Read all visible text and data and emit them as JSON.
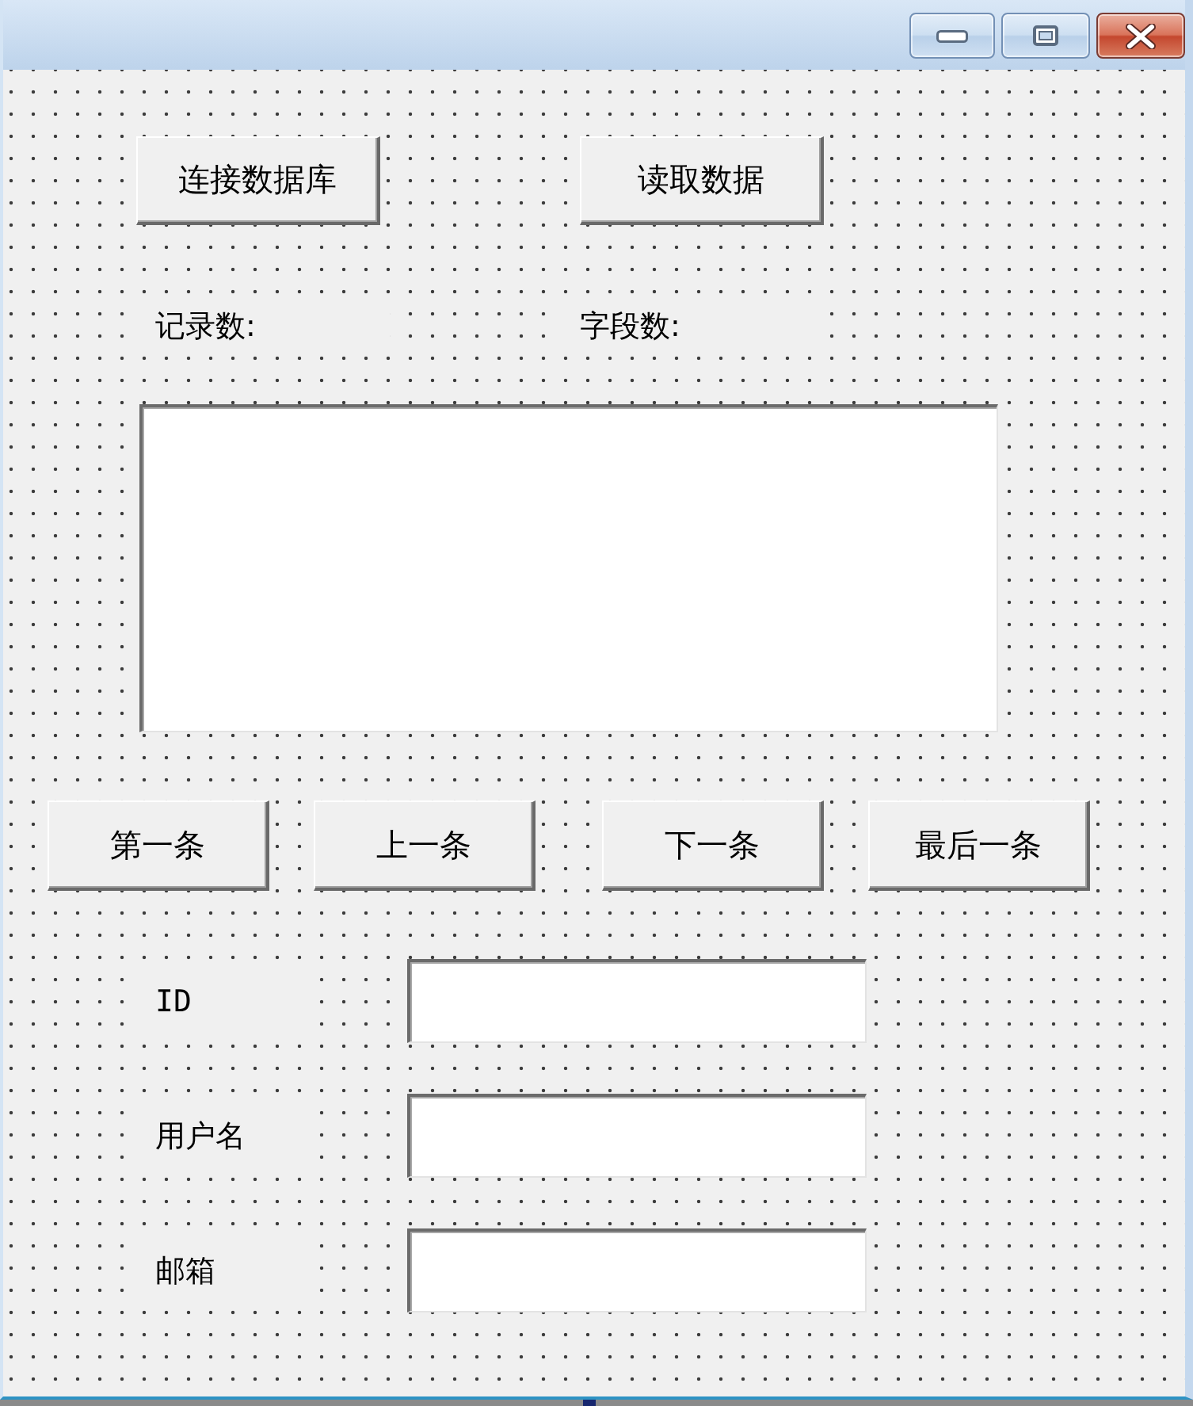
{
  "top_buttons": [
    {
      "label": "连接数据库"
    },
    {
      "label": "读取数据"
    }
  ],
  "count_labels": [
    {
      "label": "记录数:"
    },
    {
      "label": "字段数:"
    }
  ],
  "navigation_buttons": [
    {
      "label": "第一条"
    },
    {
      "label": "上一条"
    },
    {
      "label": "下一条"
    },
    {
      "label": "最后一条"
    }
  ],
  "fields": [
    {
      "label": "ID"
    },
    {
      "label": "用户名"
    },
    {
      "label": "邮箱"
    }
  ]
}
